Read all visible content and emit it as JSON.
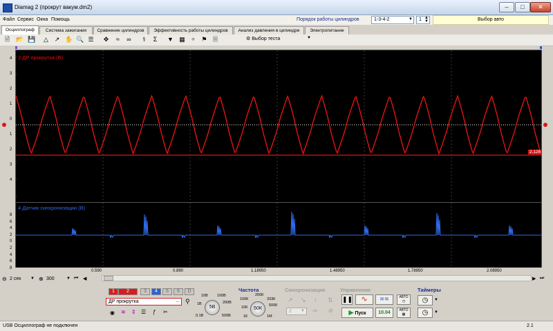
{
  "window": {
    "title": "Diamag 2 (прокрут вакум.dm2)"
  },
  "menu": [
    "Файл",
    "Сервис",
    "Окна",
    "Помощь"
  ],
  "cylinders": {
    "label": "Порядок работы цилиндров",
    "order": "1-3-4-2",
    "cylinder": "1",
    "auto_button": "Выбор авто"
  },
  "tabs": [
    "Осциллограф",
    "Система зажигания",
    "Сравнение цилиндров",
    "Эффективность работы цилиндров",
    "Анализ давления в цилиндре",
    "Электропитание"
  ],
  "toolbar": {
    "test_select": "Выбор теста"
  },
  "ch1": {
    "label": "2 ДР прокрутка (В)",
    "color": "#e01414",
    "ticks": [
      "4",
      "3",
      "2",
      "1",
      "0",
      "1",
      "2",
      "3",
      "4"
    ],
    "marker_value": "2.126"
  },
  "ch2": {
    "label": "4 Датчик синхронизации (В)",
    "color": "#2f6ae8",
    "ticks": [
      "8",
      "6",
      "4",
      "2",
      "0",
      "2",
      "4",
      "6",
      "8"
    ]
  },
  "xaxis_labels": [
    "0.590",
    "0.890",
    "1.18950",
    "1.48950",
    "1.78950",
    "2.08950"
  ],
  "time": {
    "scale": "2 сек",
    "points": "300"
  },
  "channels": [
    "1",
    "2",
    "3",
    "4",
    "5",
    "6",
    "D"
  ],
  "input": {
    "name": "ДР прокрутка",
    "dots": "..."
  },
  "voltage_knob": {
    "center": "5В",
    "labels": [
      "10В",
      "100В",
      "1В",
      "200В",
      "0.1В",
      "500В"
    ]
  },
  "frequency": {
    "title": "Частота",
    "center": "50К",
    "labels": [
      "200К",
      "100К",
      "333К",
      "10К",
      "500К",
      "1К",
      "1М"
    ]
  },
  "sync": {
    "title": "Синхронизация",
    "value": "2"
  },
  "control": {
    "title": "Управление",
    "start": "Пуск",
    "value": "10.04",
    "auto_labels": [
      "АВТО",
      "АВТО"
    ]
  },
  "timers": {
    "title": "Таймеры"
  },
  "status": {
    "left": "USB Осциллограф не подключен",
    "right": "2.1"
  }
}
